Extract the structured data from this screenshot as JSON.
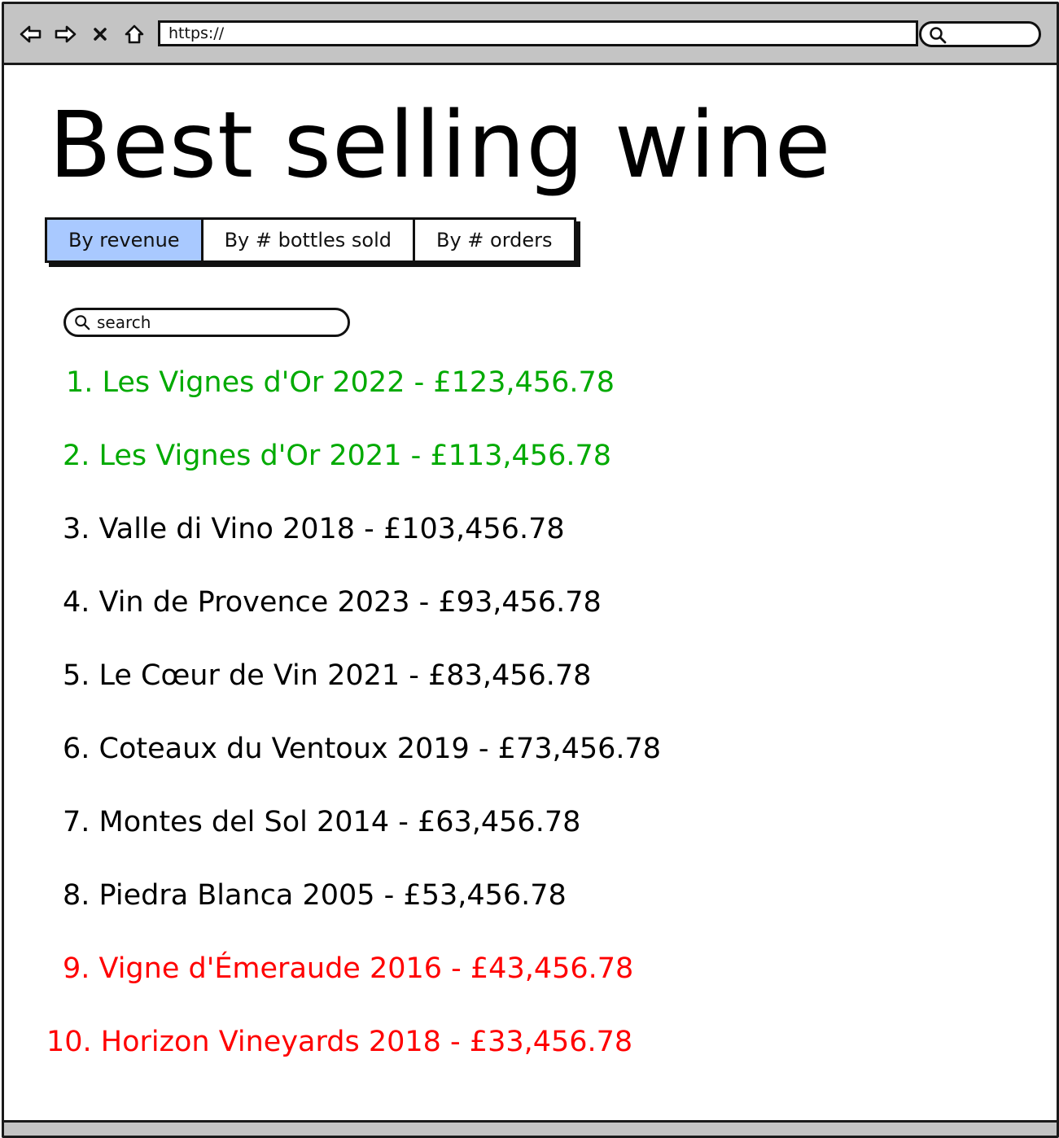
{
  "browser": {
    "url": "https://",
    "nav_icons": [
      "back-icon",
      "forward-icon",
      "close-icon",
      "home-icon"
    ]
  },
  "page": {
    "title": "Best selling wine"
  },
  "tabs": [
    {
      "label": "By revenue",
      "active": true
    },
    {
      "label": "By # bottles sold",
      "active": false
    },
    {
      "label": "By # orders",
      "active": false
    }
  ],
  "search": {
    "placeholder": "search"
  },
  "colors": {
    "top": "#00aa00",
    "normal": "#000000",
    "bottom": "#ff0000",
    "active_tab": "#a9c9ff"
  },
  "rankings": [
    {
      "text": "1. Les Vignes d'Or 2022  - £123,456.78",
      "tier": "top"
    },
    {
      "text": "2. Les Vignes d'Or 2021 - £113,456.78",
      "tier": "top"
    },
    {
      "text": "3. Valle di Vino 2018 - £103,456.78",
      "tier": "normal"
    },
    {
      "text": "4. Vin de Provence 2023 - £93,456.78",
      "tier": "normal"
    },
    {
      "text": "5. Le Cœur de Vin 2021 - £83,456.78",
      "tier": "normal"
    },
    {
      "text": "6. Coteaux du Ventoux 2019 - £73,456.78",
      "tier": "normal"
    },
    {
      "text": "7. Montes del Sol 2014 - £63,456.78",
      "tier": "normal"
    },
    {
      "text": "8. Piedra Blanca 2005 - £53,456.78",
      "tier": "normal"
    },
    {
      "text": "9. Vigne d'Émeraude 2016 - £43,456.78",
      "tier": "bottom"
    },
    {
      "text": "10. Horizon Vineyards 2018 - £33,456.78",
      "tier": "bottom"
    }
  ]
}
